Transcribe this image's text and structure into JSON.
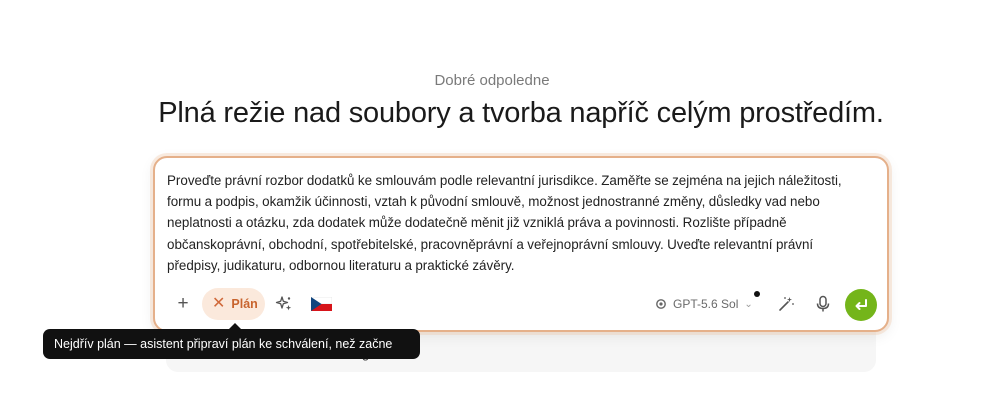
{
  "header": {
    "greeting": "Dobré odpoledne",
    "headline": "Plná režie nad soubory a tvorba napříč celým prostředím."
  },
  "composer": {
    "prompt_text": "Proveďte právní rozbor dodatků ke smlouvám podle relevantní jurisdikce. Zaměřte se zejména na jejich náležitosti,\nformu a podpis, okamžik účinnosti, vztah k původní smlouvě, možnost jednostranné změny, důsledky vad nebo\nneplatnosti a otázku, zda dodatek může dodatečně měnit již vzniklá práva a povinnosti. Rozlište případně\nobčanskoprávní, obchodní, spotřebitelské, pracovněprávní a veřejnoprávní smlouvy. Uveďte relevantní právní\npředpisy, judikaturu, odbornou literaturu a praktické závěry.",
    "add_label": "+",
    "plan_chip": {
      "label": "Plán",
      "icon": "close-icon"
    },
    "sparkle_icon": "sparkle-icon",
    "language_flag": "czech-flag-icon",
    "model": {
      "name": "GPT-5.6 Sol",
      "icon": "model-icon"
    },
    "wand_icon": "magic-wand-icon",
    "mic_icon": "microphone-icon",
    "send_icon": "enter-arrow-icon"
  },
  "under_panel": {
    "agent_text": "genta"
  },
  "tooltip": {
    "text": "Nejdřív plán — asistent připraví plán ke schválení, než začne jednat"
  },
  "colors": {
    "accent_border": "#e5b08a",
    "plan_chip_bg": "#fbe9dc",
    "plan_chip_text": "#c8642e",
    "send_button": "#74b51a",
    "tooltip_bg": "#111111"
  }
}
